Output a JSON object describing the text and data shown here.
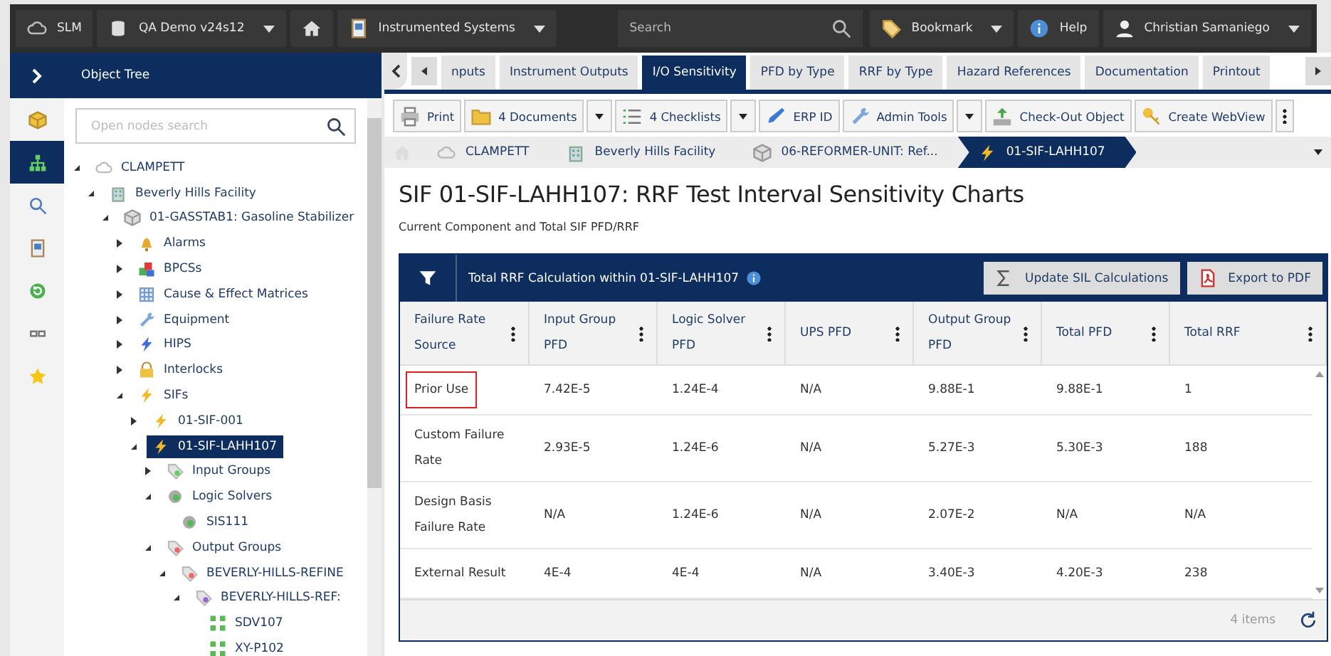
{
  "topbar": {
    "items": [
      {
        "kind": "app",
        "label": "SLM",
        "dropdown": false
      },
      {
        "kind": "database",
        "label": "QA Demo v24s12",
        "dropdown": true
      },
      {
        "kind": "home",
        "dropdown": false
      },
      {
        "kind": "module",
        "label": "Instrumented Systems",
        "dropdown": true
      }
    ],
    "search": {
      "placeholder": "Search"
    },
    "right_items": [
      {
        "kind": "bookmark",
        "label": "Bookmark",
        "dropdown": true
      },
      {
        "kind": "help",
        "label": "Help",
        "dropdown": false
      },
      {
        "kind": "user",
        "label": "Christian Samaniego",
        "dropdown": true
      }
    ]
  },
  "sidebar": {
    "title": "Object Tree",
    "rail": [
      {
        "kind": "objects",
        "selected": false
      },
      {
        "kind": "tree",
        "selected": true
      },
      {
        "kind": "search",
        "selected": false
      },
      {
        "kind": "reports",
        "selected": false
      },
      {
        "kind": "sync",
        "selected": false
      },
      {
        "kind": "links",
        "selected": false
      },
      {
        "kind": "favorites",
        "selected": false
      }
    ],
    "search": {
      "placeholder": "Open nodes search"
    },
    "tree": [
      {
        "label": "CLAMPETT",
        "kind": "site",
        "selected": false,
        "expanded": true,
        "children": [
          {
            "label": "Beverly Hills Facility",
            "kind": "facility",
            "selected": false,
            "expanded": true,
            "children": [
              {
                "label": "01-GASSTAB1: Gasoline Stabilizer",
                "kind": "unit",
                "selected": false,
                "expanded": true,
                "children": [
                  {
                    "label": "Alarms",
                    "kind": "alarms",
                    "selected": false,
                    "expanded": false
                  },
                  {
                    "label": "BPCSs",
                    "kind": "bpcs",
                    "selected": false,
                    "expanded": false
                  },
                  {
                    "label": "Cause & Effect Matrices",
                    "kind": "matrix",
                    "selected": false,
                    "expanded": false
                  },
                  {
                    "label": "Equipment",
                    "kind": "equipment",
                    "selected": false,
                    "expanded": false
                  },
                  {
                    "label": "HIPS",
                    "kind": "hips",
                    "selected": false,
                    "expanded": false
                  },
                  {
                    "label": "Interlocks",
                    "kind": "interlock",
                    "selected": false,
                    "expanded": false
                  },
                  {
                    "label": "SIFs",
                    "kind": "sif",
                    "selected": false,
                    "expanded": true,
                    "children": [
                      {
                        "label": "01-SIF-001",
                        "kind": "sif",
                        "selected": false,
                        "expanded": false
                      },
                      {
                        "label": "01-SIF-LAHH107",
                        "kind": "sif",
                        "selected": true,
                        "expanded": true,
                        "children": [
                          {
                            "label": "Input Groups",
                            "kind": "input_group",
                            "selected": false,
                            "expanded": false
                          },
                          {
                            "label": "Logic Solvers",
                            "kind": "logic_solver",
                            "selected": false,
                            "expanded": true,
                            "children": [
                              {
                                "label": "SIS111",
                                "kind": "logic_solver",
                                "selected": false
                              }
                            ]
                          },
                          {
                            "label": "Output Groups",
                            "kind": "output_group",
                            "selected": false,
                            "expanded": true,
                            "children": [
                              {
                                "label": "BEVERLY-HILLS-REFINE",
                                "kind": "output_group",
                                "selected": false,
                                "expanded": true,
                                "children": [
                                  {
                                    "label": "BEVERLY-HILLS-REF:",
                                    "kind": "output_subgroup",
                                    "selected": false,
                                    "expanded": true,
                                    "children": [
                                      {
                                        "label": "SDV107",
                                        "kind": "device",
                                        "selected": false
                                      },
                                      {
                                        "label": "XY-P102",
                                        "kind": "device",
                                        "selected": false
                                      }
                                    ]
                                  }
                                ]
                              }
                            ]
                          }
                        ]
                      }
                    ]
                  }
                ]
              }
            ]
          }
        ]
      }
    ]
  },
  "tabs": [
    {
      "label": "nputs",
      "selected": false
    },
    {
      "label": "Instrument Outputs",
      "selected": false
    },
    {
      "label": "I/O Sensitivity",
      "selected": true
    },
    {
      "label": "PFD by Type",
      "selected": false
    },
    {
      "label": "RRF by Type",
      "selected": false
    },
    {
      "label": "Hazard References",
      "selected": false
    },
    {
      "label": "Documentation",
      "selected": false
    },
    {
      "label": "Printout",
      "selected": false
    }
  ],
  "toolbar": [
    {
      "kind": "print",
      "label": "Print",
      "dropdown": false
    },
    {
      "kind": "documents",
      "label": "4 Documents",
      "dropdown": true
    },
    {
      "kind": "checklists",
      "label": "4 Checklists",
      "dropdown": true
    },
    {
      "kind": "erp",
      "label": "ERP ID",
      "dropdown": false
    },
    {
      "kind": "admin",
      "label": "Admin Tools",
      "dropdown": true
    },
    {
      "kind": "checkout",
      "label": "Check-Out Object",
      "dropdown": false
    },
    {
      "kind": "webview",
      "label": "Create WebView",
      "dropdown": false
    }
  ],
  "breadcrumb": [
    {
      "kind": "site",
      "label": "CLAMPETT",
      "current": false
    },
    {
      "kind": "facility",
      "label": "Beverly Hills Facility",
      "current": false
    },
    {
      "kind": "unit",
      "label": "06-REFORMER-UNIT: Ref...",
      "current": false
    },
    {
      "kind": "sif",
      "label": "01-SIF-LAHH107",
      "current": true
    }
  ],
  "page": {
    "title": "SIF 01-SIF-LAHH107: RRF Test Interval Sensitivity Charts",
    "subtitle": "Current Component and Total SIF PFD/RRF"
  },
  "grid": {
    "title": "Total RRF Calculation within 01-SIF-LAHH107",
    "buttons": [
      {
        "kind": "sigma",
        "label": "Update SIL Calculations"
      },
      {
        "kind": "pdf",
        "label": "Export to PDF"
      }
    ],
    "columns": [
      "Failure Rate Source",
      "Input Group PFD",
      "Logic Solver PFD",
      "UPS PFD",
      "Output Group PFD",
      "Total PFD",
      "Total RRF"
    ],
    "rows": [
      {
        "cells": [
          "Prior Use",
          "7.42E-5",
          "1.24E-4",
          "N/A",
          "9.88E-1",
          "9.88E-1",
          "1"
        ],
        "outlined": true
      },
      {
        "cells": [
          "Custom Failure Rate",
          "2.93E-5",
          "1.24E-6",
          "N/A",
          "5.27E-3",
          "5.30E-3",
          "188"
        ],
        "outlined": false
      },
      {
        "cells": [
          "Design Basis Failure Rate",
          "N/A",
          "1.24E-6",
          "N/A",
          "2.07E-2",
          "N/A",
          "N/A"
        ],
        "outlined": false
      },
      {
        "cells": [
          "External Result",
          "4E-4",
          "4E-4",
          "N/A",
          "3.40E-3",
          "4.20E-3",
          "238"
        ],
        "outlined": false
      }
    ],
    "item_count": "4 items"
  }
}
